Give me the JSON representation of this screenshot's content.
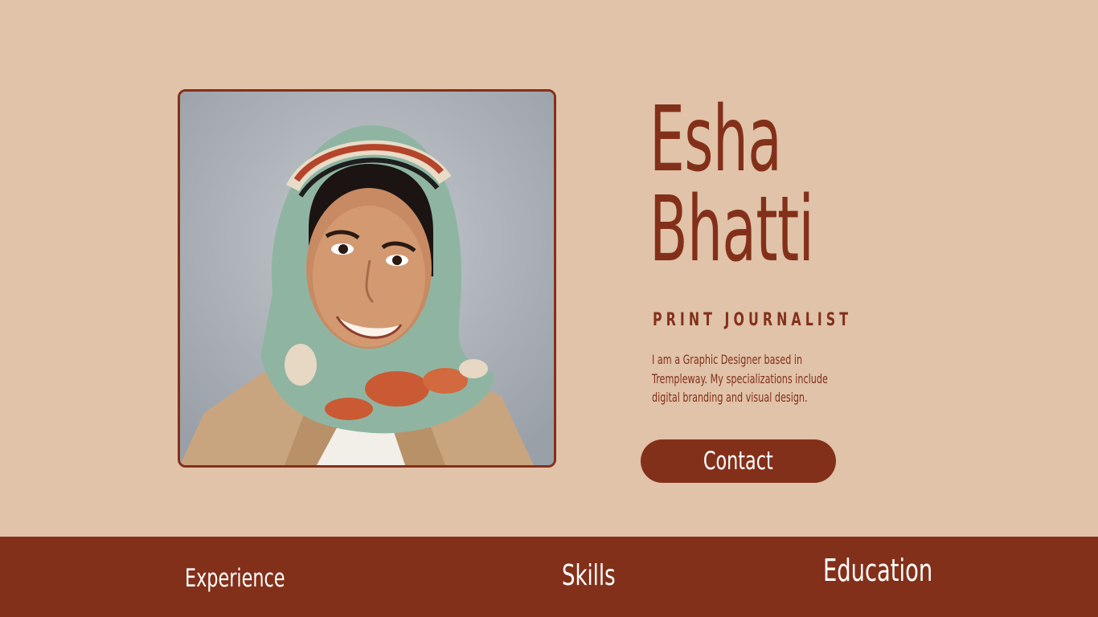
{
  "profile": {
    "first_name": "Esha",
    "last_name": "Bhatti",
    "role": "PRINT JOURNALIST",
    "bio": "I am a Graphic Designer based in Trempleway. My specializations include digital branding and visual design.",
    "photo_icon": "portrait-photo"
  },
  "actions": {
    "contact_label": "Contact"
  },
  "nav": {
    "items": [
      {
        "label": "Experience"
      },
      {
        "label": "Skills"
      },
      {
        "label": "Education"
      }
    ]
  },
  "colors": {
    "background": "#e0c3a9",
    "accent": "#83301a",
    "text_on_accent": "#ffffff"
  }
}
